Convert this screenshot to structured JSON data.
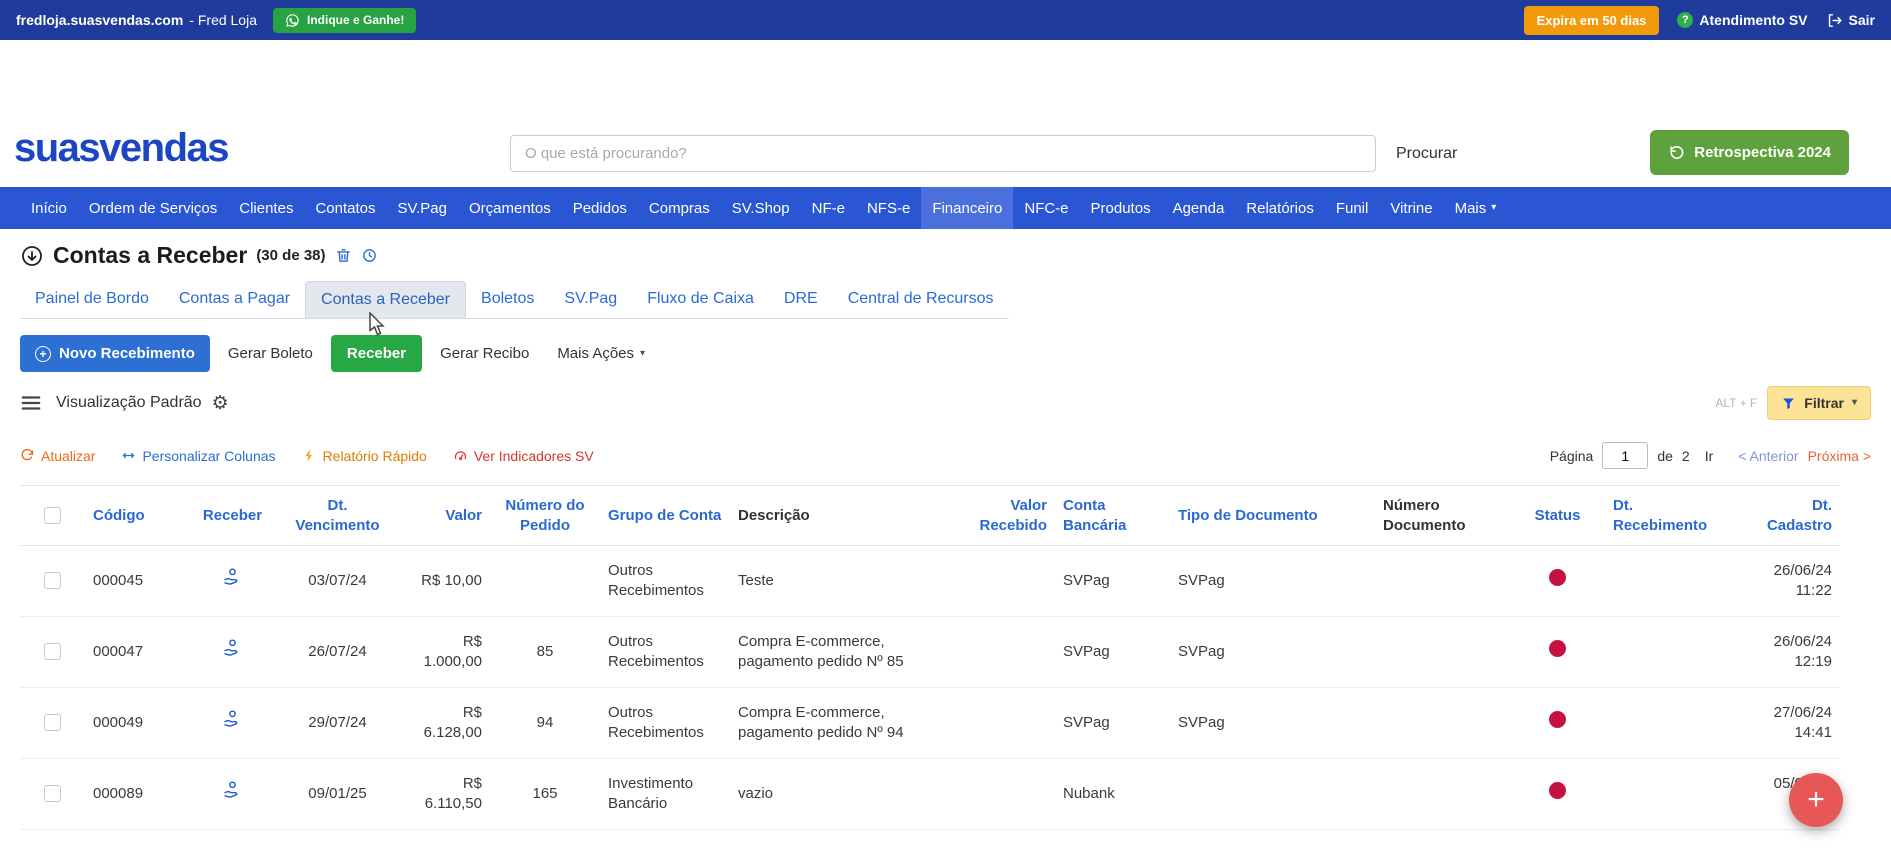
{
  "colors": {
    "topbar_bg": "#1f3c9c",
    "nav_bg": "#2a56d4",
    "green": "#28a745",
    "orange": "#f09a0c",
    "primary_blue": "#2d6fd3",
    "link_blue": "#2b6cd4",
    "link_orange": "#f06a12",
    "filter_yellow": "#fde395",
    "status_red": "#c51243",
    "fab_red": "#e85758"
  },
  "topbar": {
    "domain": "fredloja.suasvendas.com",
    "account": "- Fred Loja",
    "refer_label": "Indique e Ganhe!",
    "expira_label": "Expira em 50 dias",
    "atendimento_label": "Atendimento SV",
    "sair_label": "Sair"
  },
  "header": {
    "logo_part1": "suas",
    "logo_part2": "v",
    "logo_part3": "endas",
    "search_placeholder": "O que está procurando?",
    "procurar_label": "Procurar",
    "retrospectiva_label": "Retrospectiva 2024"
  },
  "nav": {
    "items": [
      {
        "label": "Início"
      },
      {
        "label": "Ordem de Serviços"
      },
      {
        "label": "Clientes"
      },
      {
        "label": "Contatos"
      },
      {
        "label": "SV.Pag"
      },
      {
        "label": "Orçamentos"
      },
      {
        "label": "Pedidos"
      },
      {
        "label": "Compras"
      },
      {
        "label": "SV.Shop"
      },
      {
        "label": "NF-e"
      },
      {
        "label": "NFS-e"
      },
      {
        "label": "Financeiro",
        "active": true
      },
      {
        "label": "NFC-e"
      },
      {
        "label": "Produtos"
      },
      {
        "label": "Agenda"
      },
      {
        "label": "Relatórios"
      },
      {
        "label": "Funil"
      },
      {
        "label": "Vitrine"
      },
      {
        "label": "Mais",
        "caret": true
      }
    ]
  },
  "page": {
    "title": "Contas a Receber",
    "count": "(30 de 38)"
  },
  "tabs": {
    "items": [
      "Painel de Bordo",
      "Contas a Pagar",
      "Contas a Receber",
      "Boletos",
      "SV.Pag",
      "Fluxo de Caixa",
      "DRE",
      "Central de Recursos"
    ],
    "active": "Contas a Receber"
  },
  "actions": {
    "novo_recebimento": "Novo Recebimento",
    "gerar_boleto": "Gerar Boleto",
    "receber": "Receber",
    "gerar_recibo": "Gerar Recibo",
    "mais_acoes": "Mais Ações"
  },
  "view": {
    "label": "Visualização Padrão",
    "shortcut": "ALT + F",
    "filtrar": "Filtrar"
  },
  "toolbar": {
    "atualizar": "Atualizar",
    "personalizar_colunas": "Personalizar Colunas",
    "relatorio_rapido": "Relatório Rápido",
    "ver_indicadores": "Ver Indicadores SV"
  },
  "pagination": {
    "pagina_label": "Página",
    "page_value": "1",
    "de_label": "de",
    "total_pages": "2",
    "ir_label": "Ir",
    "anterior_label": "< Anterior",
    "proxima_label": "Próxima >"
  },
  "table": {
    "headers": [
      "Código",
      "Receber",
      "Dt. Vencimento",
      "Valor",
      "Número do Pedido",
      "Grupo de Conta",
      "Descrição",
      "Valor Recebido",
      "Conta Bancária",
      "Tipo de Documento",
      "Número Documento",
      "Status",
      "Dt. Recebimento",
      "Dt. Cadastro"
    ],
    "rows": [
      {
        "codigo": "000045",
        "vencimento": "03/07/24",
        "valor": "R$ 10,00",
        "pedido": "",
        "grupo": "Outros Recebimentos",
        "descricao": "Teste",
        "valor_recebido": "",
        "conta": "SVPag",
        "tipo_doc": "SVPag",
        "num_doc": "",
        "status": "red",
        "recebimento": "",
        "cadastro": "26/06/24 11:22"
      },
      {
        "codigo": "000047",
        "vencimento": "26/07/24",
        "valor": "R$ 1.000,00",
        "pedido": "85",
        "grupo": "Outros Recebimentos",
        "descricao": "Compra E-commerce, pagamento pedido Nº 85",
        "valor_recebido": "",
        "conta": "SVPag",
        "tipo_doc": "SVPag",
        "num_doc": "",
        "status": "red",
        "recebimento": "",
        "cadastro": "26/06/24 12:19"
      },
      {
        "codigo": "000049",
        "vencimento": "29/07/24",
        "valor": "R$ 6.128,00",
        "pedido": "94",
        "grupo": "Outros Recebimentos",
        "descricao": "Compra E-commerce, pagamento pedido Nº 94",
        "valor_recebido": "",
        "conta": "SVPag",
        "tipo_doc": "SVPag",
        "num_doc": "",
        "status": "red",
        "recebimento": "",
        "cadastro": "27/06/24 14:41"
      },
      {
        "codigo": "000089",
        "vencimento": "09/01/25",
        "valor": "R$ 6.110,50",
        "pedido": "165",
        "grupo": "Investimento Bancário",
        "descricao": "vazio",
        "valor_recebido": "",
        "conta": "Nubank",
        "tipo_doc": "",
        "num_doc": "",
        "status": "red",
        "recebimento": "",
        "cadastro": "05/07/24 05:48"
      }
    ]
  },
  "fab": {
    "label": "+"
  }
}
